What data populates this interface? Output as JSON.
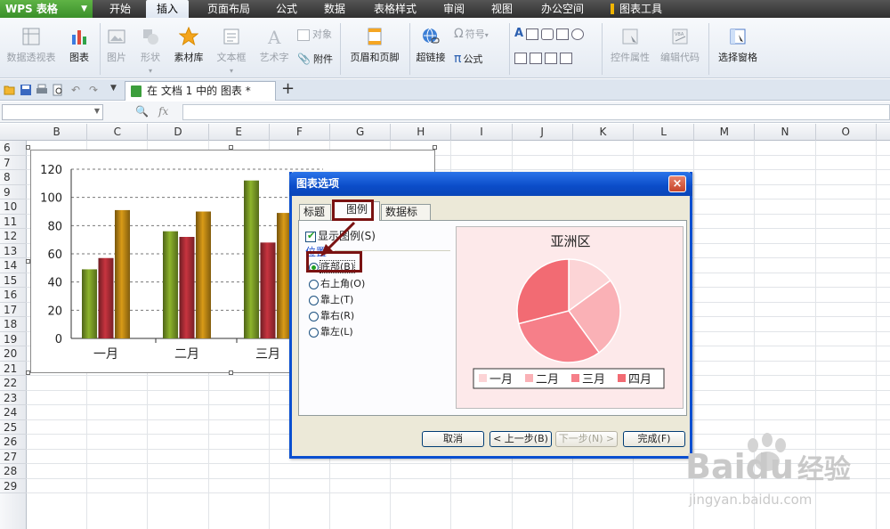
{
  "app": {
    "name": "WPS 表格"
  },
  "menu_tabs": [
    "开始",
    "插入",
    "页面布局",
    "公式",
    "数据",
    "表格样式",
    "审阅",
    "视图",
    "办公空间",
    "图表工具"
  ],
  "active_menu_tab": "插入",
  "ribbon": {
    "pivot": "数据透视表",
    "chart": "图表",
    "picture": "图片",
    "shape": "形状",
    "material": "素材库",
    "textbox": "文本框",
    "wordart": "艺术字",
    "object": "对象",
    "attachment": "附件",
    "header_footer": "页眉和页脚",
    "hyperlink": "超链接",
    "symbol": "符号",
    "formula": "公式",
    "control_props": "控件属性",
    "edit_code": "编辑代码",
    "select_pane": "选择窗格"
  },
  "doc_tab": {
    "title": "在 文档 1 中的 图表 *"
  },
  "formula_bar": {
    "fx": "fx"
  },
  "columns": [
    "B",
    "C",
    "D",
    "E",
    "F",
    "G",
    "H",
    "I",
    "J",
    "K",
    "L",
    "M",
    "N",
    "O"
  ],
  "rows": [
    "6",
    "7",
    "8",
    "9",
    "10",
    "11",
    "12",
    "13",
    "14",
    "15",
    "16",
    "17",
    "18",
    "19",
    "20",
    "21",
    "22",
    "23",
    "24",
    "25",
    "26",
    "27",
    "28",
    "29"
  ],
  "chart_data": [
    {
      "type": "bar",
      "categories": [
        "一月",
        "二月",
        "三月"
      ],
      "series": [
        {
          "values": [
            49,
            76,
            112
          ]
        },
        {
          "values": [
            57,
            72,
            68
          ]
        },
        {
          "values": [
            91,
            90,
            89
          ]
        }
      ],
      "ylim": [
        0,
        120
      ],
      "yticks": [
        0,
        20,
        40,
        60,
        80,
        100,
        120
      ],
      "grid": true,
      "colors": [
        "#8db42c",
        "#c8343f",
        "#d99b17"
      ]
    },
    {
      "type": "pie",
      "title": "亚洲区",
      "categories": [
        "一月",
        "二月",
        "三月",
        "四月"
      ],
      "values": [
        15,
        25,
        31,
        29
      ],
      "colors": [
        "#fcd4d6",
        "#fab1b6",
        "#f67f89",
        "#f26b73"
      ],
      "legend": "bottom"
    }
  ],
  "dialog": {
    "title": "图表选项",
    "close": "×",
    "tabs": [
      "标题",
      "图例",
      "数据标志"
    ],
    "active_tab": "图例",
    "show_legend": "显示图例(S)",
    "position_label": "位置",
    "positions": [
      "底部(B)",
      "右上角(O)",
      "靠上(T)",
      "靠右(R)",
      "靠左(L)"
    ],
    "selected_position": "底部(B)",
    "buttons": {
      "cancel": "取消",
      "prev": "< 上一步(B)",
      "next": "下一步(N) >",
      "finish": "完成(F)"
    }
  },
  "watermark": {
    "brand": "Bai",
    "brand2": "du",
    "cn": "经验",
    "url": "jingyan.baidu.com"
  }
}
